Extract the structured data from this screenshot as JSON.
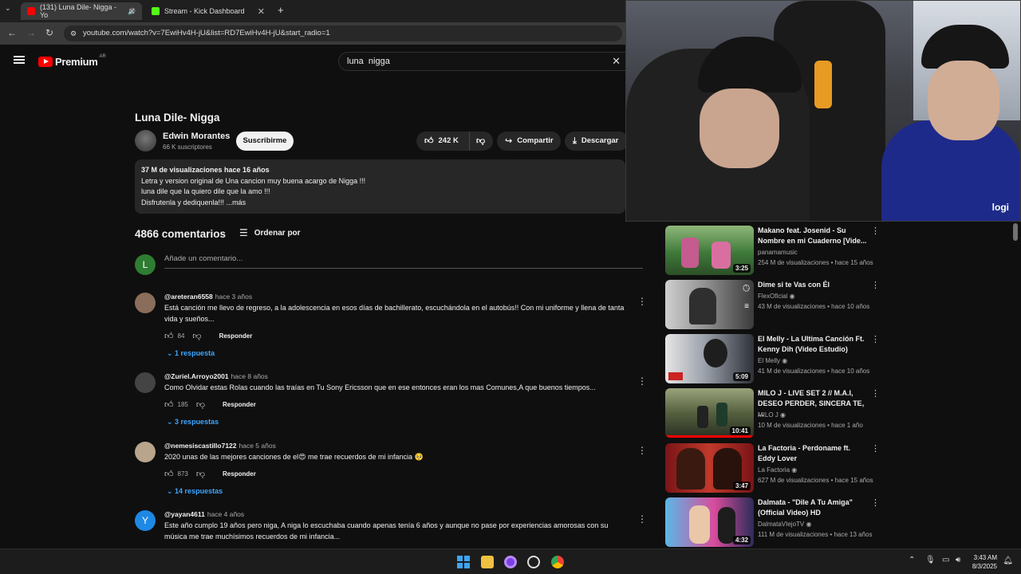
{
  "browser": {
    "tabs": [
      {
        "label": "(131) Luna Dile- Nigga - Yo",
        "active": true,
        "color": "#ff0000"
      },
      {
        "label": "Stream - Kick Dashboard",
        "active": false,
        "color": "#53fc18"
      }
    ],
    "new_tab": "+",
    "url": "youtube.com/watch?v=7EwiHv4H-jU&list=RD7EwiHv4H-jU&start_radio=1"
  },
  "youtube": {
    "logo_text": "Premium",
    "region": "AR",
    "search_value": "luna  nigga"
  },
  "video": {
    "title": "Luna Dile- Nigga",
    "channel": "Edwin Morantes",
    "subscribers": "66 K suscriptores",
    "subscribe_label": "Suscribirme",
    "likes": "242 K",
    "share_label": "Compartir",
    "download_label": "Descargar",
    "description": {
      "meta": "37 M de visualizaciones  hace 16 años",
      "lines": [
        "Letra y version original de Una cancion muy buena acargo de Nigga !!!",
        "luna dile que la quiero dile que la amo !!!",
        "Disfrutenla y dediquenla!!! ...más"
      ]
    }
  },
  "comments": {
    "count": "4866 comentarios",
    "sort_label": "Ordenar por",
    "user_initial": "L",
    "placeholder": "Añade un comentario...",
    "reply_label": "Responder",
    "items": [
      {
        "author": "@areteran6558",
        "time": "hace 3 años",
        "text": "Está canción me llevo de regreso, a la adolescencia en esos días de bachillerato, escuchándola en el autobús!! Con mi uniforme y llena de tanta vida y sueños...",
        "likes": "84",
        "replies": "1 respuesta",
        "avatar_color": "#8a6d5a"
      },
      {
        "author": "@Zuriel.Arroyo2001",
        "time": "hace 8 años",
        "text": "Como Olvidar estas Rolas cuando las traías en Tu Sony Ericsson que en ese entonces eran los mas Comunes,A que buenos tiempos...",
        "likes": "185",
        "replies": "3 respuestas",
        "avatar_color": "#444444"
      },
      {
        "author": "@nemesiscastillo7122",
        "time": "hace 5 años",
        "text": "2020 unas de las mejores canciones de el😍 me trae recuerdos de mi infancia 🥺",
        "likes": "873",
        "replies": "14 respuestas",
        "avatar_color": "#b9a48c"
      },
      {
        "author": "@yayan4611",
        "time": "hace 4 años",
        "text": "Este año cumplo 19 años pero niga, A niga lo escuchaba cuando apenas tenía 6 años y aunque no pase por experiencias amorosas con su música me trae muchísimos recuerdos de mi infancia...",
        "avatar_color": "#1e88e5",
        "avatar_initial": "Y"
      }
    ]
  },
  "recommendations": [
    {
      "title": "Makano feat. Josenid - Su Nombre en mi Cuaderno [Vide...",
      "channel": "panamamusic",
      "stats": "254 M de visualizaciones • hace 15 años",
      "duration": "3:25",
      "thumb_color": "#3f7a3a"
    },
    {
      "title": "Dime si te Vas con Él",
      "channel": "FlexOficial",
      "stats": "43 M de visualizaciones • hace 10 años",
      "duration": "",
      "thumb_color": "#6a6a6a"
    },
    {
      "title": "El Melly - La Ultima Canción Ft. Kenny Dih (Video Estudio)",
      "channel": "El Melly",
      "stats": "41 M de visualizaciones • hace 10 años",
      "duration": "5:09",
      "thumb_color": "#7b7f88"
    },
    {
      "title": "MILO J - LIVE SET 2 // M.A.I, DESEO PERDER, SINCERA TE, ...",
      "channel": "MILO J",
      "stats": "10 M de visualizaciones • hace 1 año",
      "duration": "10:41",
      "thumb_color": "#55603f"
    },
    {
      "title": "La Factoria - Perdoname ft. Eddy Lover",
      "channel": "La Factoria",
      "stats": "627 M de visualizaciones • hace 15 años",
      "duration": "3:47",
      "thumb_color": "#a0282a"
    },
    {
      "title": "Dalmata - \"Dile A Tu Amiga\" (Official Video) HD",
      "channel": "DalmataVIejoTV",
      "stats": "111 M de visualizaciones • hace 13 años",
      "duration": "4:32",
      "thumb_color": "#3a86c8"
    }
  ],
  "webcam": {
    "brand": "logi"
  },
  "taskbar": {
    "time": "3:43 AM",
    "date": "8/3/2025"
  }
}
